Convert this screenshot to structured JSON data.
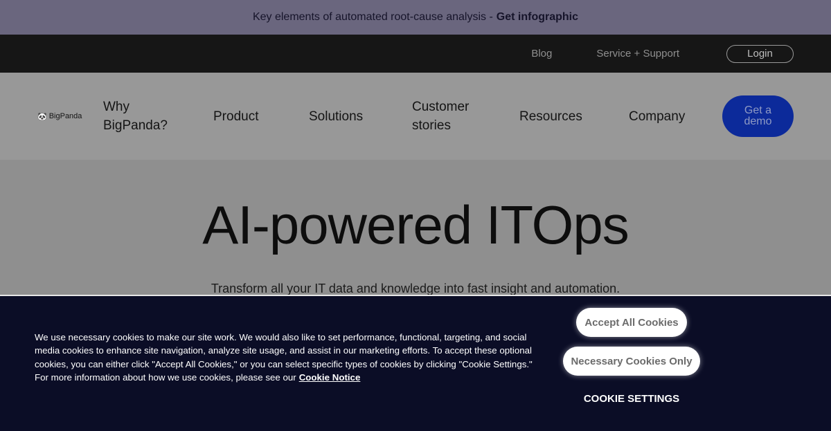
{
  "banner": {
    "text": "Key elements of automated root-cause analysis -",
    "link": "Get infographic"
  },
  "topbar": {
    "blog": "Blog",
    "support": "Service + Support",
    "login": "Login"
  },
  "nav": {
    "logo": "BigPanda",
    "items": [
      "Why BigPanda?",
      "Product",
      "Solutions",
      "Customer stories",
      "Resources",
      "Company"
    ],
    "cta": "Get a demo"
  },
  "hero": {
    "title": "AI-powered ITOps",
    "subtitle": "Transform all your IT data and knowledge into fast insight and automation."
  },
  "cookie": {
    "text": "We use necessary cookies to make our site work. We would also like to set performance, functional, targeting, and social media cookies to enhance site navigation, analyze site usage, and assist in our marketing efforts. To accept these optional cookies, you can either click \"Accept All Cookies,\" or you can select specific types of cookies by clicking \"Cookie Settings.\" For more information about how we use cookies, please see our",
    "notice": "Cookie Notice",
    "accept": "Accept All Cookies",
    "necessary": "Necessary Cookies Only",
    "settings": "COOKIE SETTINGS"
  }
}
